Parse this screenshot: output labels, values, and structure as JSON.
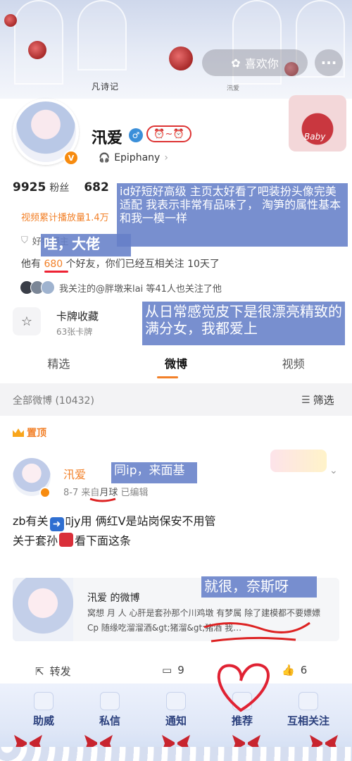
{
  "header": {
    "brand": "凡诗记",
    "sub": "汛爱",
    "like_label": "喜欢你",
    "more_label": "···"
  },
  "profile": {
    "name": "汛爱",
    "music": "Epiphany",
    "followers_value": "9925",
    "followers_label": "粉丝",
    "following_value": "682",
    "video_plays": "视频累计播放量1.4万",
    "tag": "好物博主",
    "friends_prefix": "他有",
    "friends_count": "680",
    "friends_suffix": "个好友，你们已经互相关注 10天了",
    "mutual_text": "我关注的@胖墩来lai  等41人也关注了他",
    "card_title": "卡牌收藏",
    "card_sub": "63张卡牌",
    "right_deco_text": "Baby"
  },
  "tabs": [
    {
      "label": "精选"
    },
    {
      "label": "微博"
    },
    {
      "label": "视频"
    }
  ],
  "feed": {
    "all_label": "全部微博 (10432)",
    "filter_label": "筛选",
    "pinned_label": "置顶"
  },
  "post": {
    "author": "汛爱",
    "date": "8-7",
    "from_label": "来自",
    "source": "月球",
    "edited": "已编辑",
    "line1_a": "zb有关",
    "line1_b": "jy用 俩红Ⅴ是站岗保安不用管",
    "line2_a": "关于套孙",
    "line2_b": "看下面这条",
    "repost_title": "汛爱 的微博",
    "repost_text": "窝想 月 人 心肝是套孙那个川鸡墩 有梦属 除了建模都不要嫖嫖 Cp 随缘吃溜溜酒&gt;猪溜&gt;猪酒 我…",
    "forward_label": "转发",
    "comments": "9",
    "likes": "6"
  },
  "bottom_nav": [
    {
      "label": "助威"
    },
    {
      "label": "私信"
    },
    {
      "label": "通知"
    },
    {
      "label": "推荐"
    },
    {
      "label": "互相关注"
    }
  ],
  "annotations": {
    "n1": "id好短好高级 主页太好看了吧装扮头像完美适配 我表示非常有品味了， 淘笋的属性基本和我一模一样",
    "n2": "哇，大佬",
    "n3": "从日常感觉皮下是很漂亮精致的满分女，我都爱上",
    "n4": "同ip，来面基",
    "n5": "就很，奈斯呀"
  },
  "colors": {
    "accent": "#f28028",
    "annotation": "#6580c8",
    "nav_text": "#2a3f7c"
  }
}
